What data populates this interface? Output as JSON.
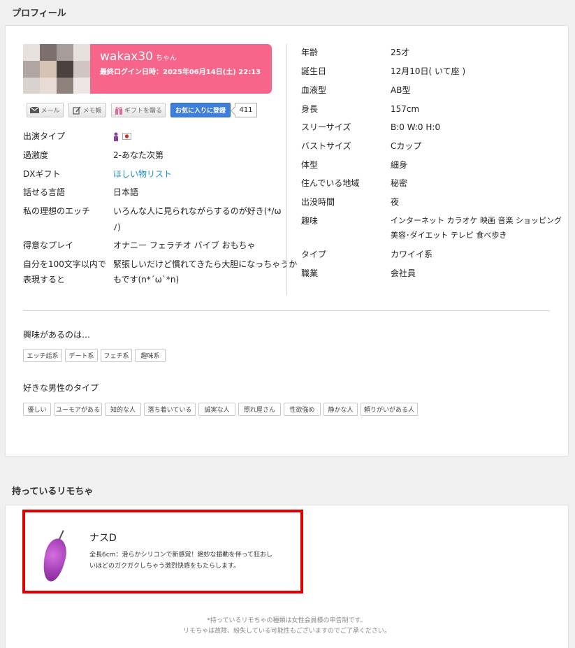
{
  "profile": {
    "section_title": "プロフィール",
    "name": "wakax30",
    "honorific": "ちゃん",
    "last_login": "最終ログイン日時：2025年06月14日(土) 22:13",
    "buttons": {
      "mail": "メール",
      "memo": "メモ帳",
      "gift": "ギフトを贈る",
      "favorite": "お気に入りに登録",
      "favorite_count": "411"
    },
    "left_fields": [
      {
        "label": "出演タイプ",
        "value": ""
      },
      {
        "label": "過激度",
        "value": "2-あなた次第"
      },
      {
        "label": "DXギフト",
        "value": "ほしい物リスト"
      },
      {
        "label": "話せる言語",
        "value": "日本語"
      },
      {
        "label": "私の理想のエッチ",
        "value": "いろんな人に見られながらするのが好き(*/ω",
        "value2": "ﾉ)"
      },
      {
        "label": "得意なプレイ",
        "value": "オナニー フェラチオ バイブ おもちゃ"
      },
      {
        "label": "自分を100文字以内で",
        "label2": "表現すると",
        "value": "緊張しいだけど慣れてきたら大胆になっちゃうか",
        "value2": "もです(n*´ω`*n)"
      }
    ],
    "right_fields": [
      {
        "label": "年齢",
        "value": "25才"
      },
      {
        "label": "誕生日",
        "value": "12月10日( いて座 )"
      },
      {
        "label": "血液型",
        "value": "AB型"
      },
      {
        "label": "身長",
        "value": "157cm"
      },
      {
        "label": "スリーサイズ",
        "value": "B:0 W:0 H:0"
      },
      {
        "label": "バストサイズ",
        "value": "Cカップ"
      },
      {
        "label": "体型",
        "value": "細身"
      },
      {
        "label": "住んでいる地域",
        "value": "秘密"
      },
      {
        "label": "出没時間",
        "value": "夜"
      },
      {
        "label": "趣味",
        "value": "インターネット カラオケ 映画 音楽 ショッピング",
        "value2": "美容･ダイエット テレビ 食べ歩き"
      },
      {
        "label": "タイプ",
        "value": "カワイイ系"
      },
      {
        "label": "職業",
        "value": "会社員"
      }
    ],
    "interests": {
      "title": "興味があるのは…",
      "tags": [
        "エッチ話系",
        "デート系",
        "フェチ系",
        "趣味系"
      ]
    },
    "preferred_type": {
      "title": "好きな男性のタイプ",
      "tags": [
        "優しい",
        "ユーモアがある",
        "知的な人",
        "落ち着いている",
        "誠実な人",
        "照れ屋さん",
        "性欲強め",
        "静かな人",
        "頼りがいがある人"
      ]
    }
  },
  "toys": {
    "section_title": "持っているリモちゃ",
    "items": [
      {
        "name": "ナスD",
        "description": "全長6cm：滑らかシリコンで新感覚！絶妙な振動を伴って狂おしいほどのガクガクしちゃう激烈快感をもたらします。",
        "icon": "eggplant-toy-icon"
      }
    ],
    "note_line1": "*持っているリモちゃの種類は女性会員様の申告制です。",
    "note_line2": "リモちゃは故障、紛失している可能性もございますのでご了承ください。"
  },
  "colors": {
    "name_card": "#f7658b",
    "favorite_button": "#3d7fd9",
    "link": "#1a8fc9",
    "highlight_box": "#e00000"
  }
}
